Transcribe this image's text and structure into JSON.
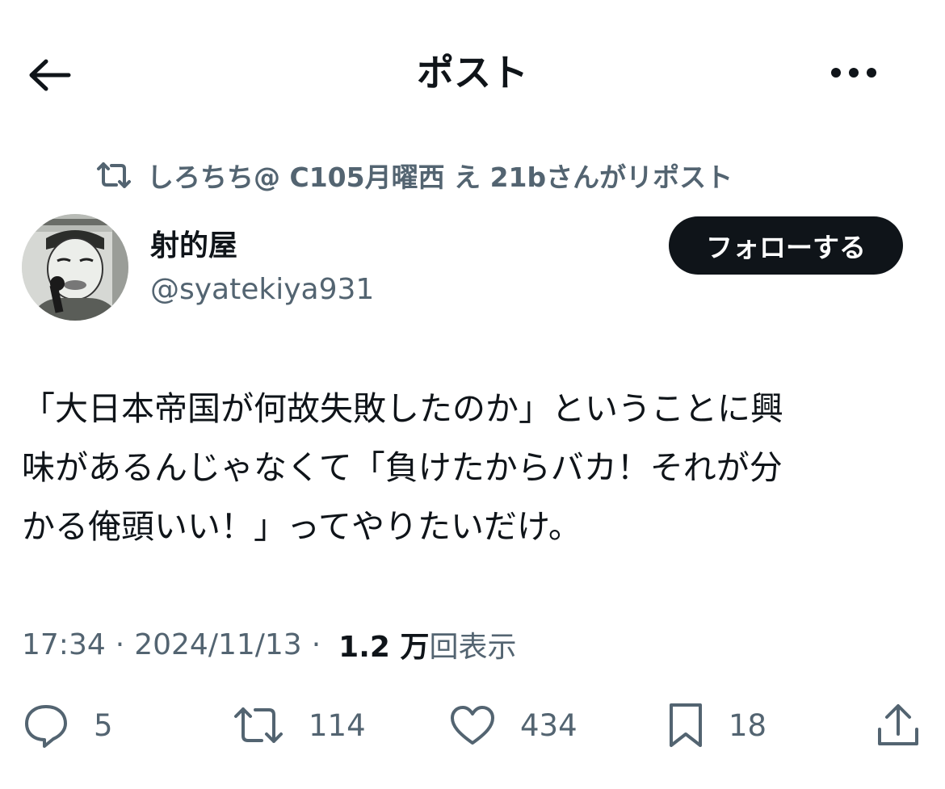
{
  "header": {
    "title": "ポスト",
    "back_icon": "arrow-left-icon",
    "more_icon": "more-horizontal-icon"
  },
  "repost_context": {
    "icon": "repost-icon",
    "text": "しろちち@ C105月曜西 え 21bさんがリポスト"
  },
  "author": {
    "display_name": "射的屋",
    "handle": "@syatekiya931",
    "avatar_icon": "avatar-image"
  },
  "follow_button": {
    "label": "フォローする"
  },
  "post": {
    "text": "「大日本帝国が何故失敗したのか」ということに興\n味があるんじゃなくて「負けたからバカ！それが分\nかる俺頭いい！」ってやりたいだけ。",
    "time": "17:34",
    "date": "2024/11/13",
    "separator": "·",
    "views_count": "1.2 万",
    "views_label": "回表示"
  },
  "actions": {
    "reply": {
      "icon": "reply-icon",
      "count": "5"
    },
    "repost": {
      "icon": "repost-icon",
      "count": "114"
    },
    "like": {
      "icon": "heart-icon",
      "count": "434"
    },
    "bookmark": {
      "icon": "bookmark-icon",
      "count": "18"
    },
    "share": {
      "icon": "share-icon"
    }
  },
  "colors": {
    "text_primary": "#0f1419",
    "text_secondary": "#536471",
    "follow_bg": "#0f1419",
    "background": "#ffffff"
  }
}
